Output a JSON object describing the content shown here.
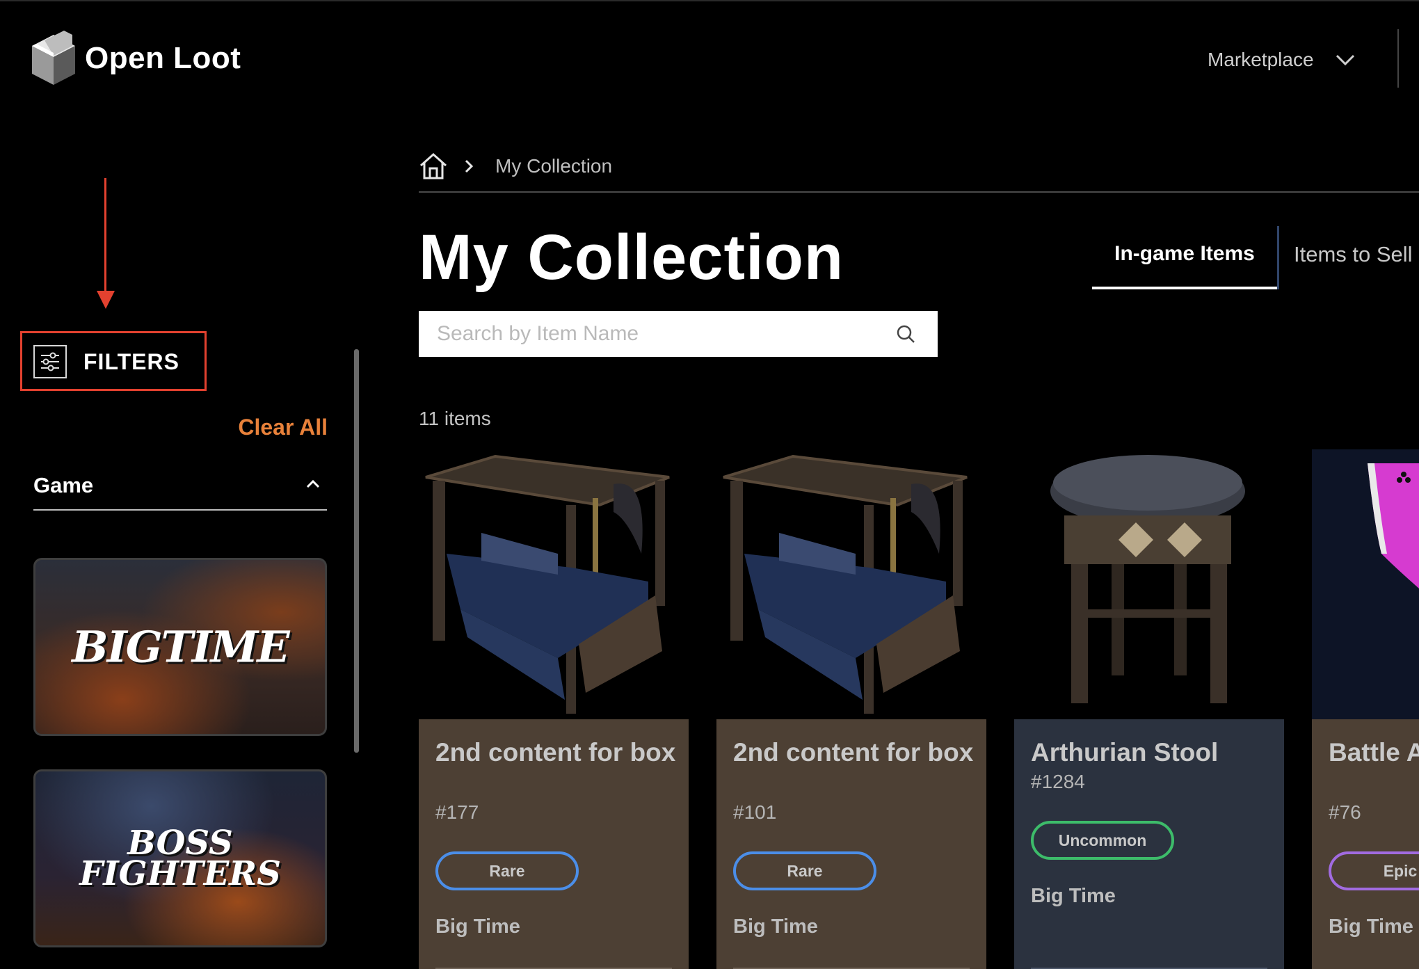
{
  "app": {
    "logo_text": "Open Loot"
  },
  "nav": {
    "marketplace_label": "Marketplace"
  },
  "sidebar": {
    "filters_label": "FILTERS",
    "clear_all_label": "Clear All",
    "game_section_label": "Game",
    "games": [
      {
        "logo_text": "BIGTIME"
      },
      {
        "logo_text": "BOSS FIGHTERS"
      }
    ]
  },
  "breadcrumb": {
    "current": "My Collection"
  },
  "main": {
    "title": "My Collection",
    "tabs": [
      {
        "label": "In-game Items"
      },
      {
        "label": "Items to Sell"
      }
    ],
    "search_placeholder": "Search by Item Name",
    "item_count": "11 items"
  },
  "items": [
    {
      "name": "2nd content for box",
      "id": "#177",
      "rarity": "Rare",
      "game": "Big Time"
    },
    {
      "name": "2nd content for box",
      "id": "#101",
      "rarity": "Rare",
      "game": "Big Time"
    },
    {
      "name": "Arthurian Stool",
      "id": "#1284",
      "rarity": "Uncommon",
      "game": "Big Time"
    },
    {
      "name": "Battle Axe Palamedes",
      "id": "#76",
      "rarity": "Epic",
      "game": "Big Time"
    }
  ],
  "colors": {
    "annotation": "#e3412f",
    "clear_all": "#e8813a",
    "rare": "#4b8ee8",
    "uncommon": "#3dbc6a",
    "epic": "#a16be0",
    "card_brown": "#4d4034",
    "card_slate": "#2b323f"
  }
}
